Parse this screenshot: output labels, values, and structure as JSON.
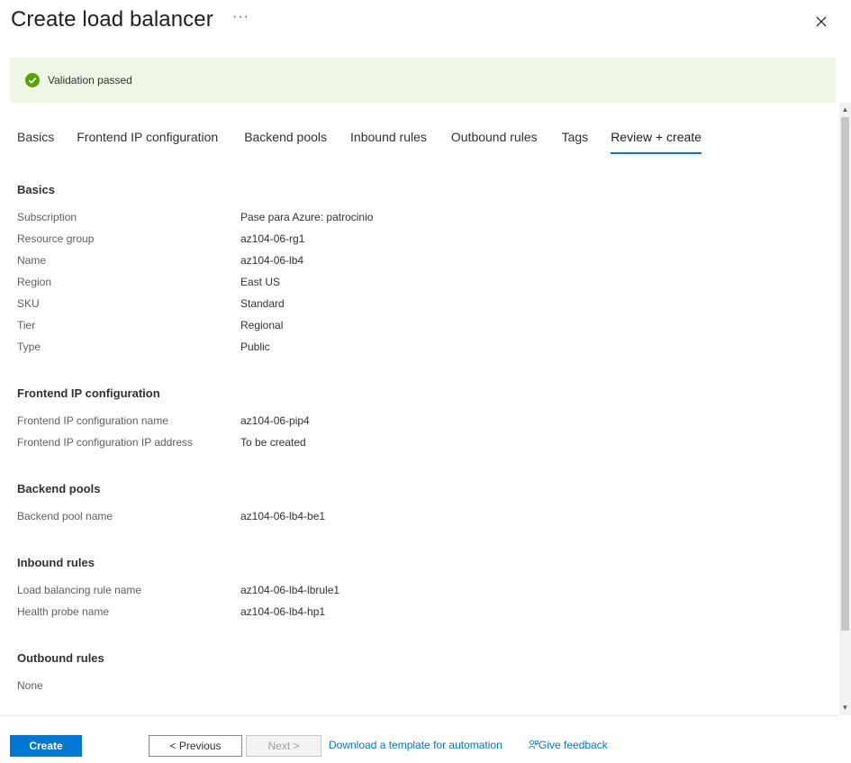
{
  "header": {
    "title": "Create load balancer",
    "more_label": "···"
  },
  "banner": {
    "text": "Validation passed",
    "icon": "check-circle-icon",
    "color": "#57a300"
  },
  "tabs": [
    {
      "label": "Basics"
    },
    {
      "label": "Frontend IP configuration"
    },
    {
      "label": "Backend pools"
    },
    {
      "label": "Inbound rules"
    },
    {
      "label": "Outbound rules"
    },
    {
      "label": "Tags"
    },
    {
      "label": "Review + create",
      "active": true
    }
  ],
  "sections": {
    "basics": {
      "title": "Basics",
      "rows": [
        {
          "label": "Subscription",
          "value": "Pase para Azure: patrocinio"
        },
        {
          "label": "Resource group",
          "value": "az104-06-rg1"
        },
        {
          "label": "Name",
          "value": "az104-06-lb4"
        },
        {
          "label": "Region",
          "value": "East US"
        },
        {
          "label": "SKU",
          "value": "Standard"
        },
        {
          "label": "Tier",
          "value": "Regional"
        },
        {
          "label": "Type",
          "value": "Public"
        }
      ]
    },
    "frontend": {
      "title": "Frontend IP configuration",
      "rows": [
        {
          "label": "Frontend IP configuration name",
          "value": "az104-06-pip4"
        },
        {
          "label": "Frontend IP configuration IP address",
          "value": "To be created"
        }
      ]
    },
    "backend": {
      "title": "Backend pools",
      "rows": [
        {
          "label": "Backend pool name",
          "value": "az104-06-lb4-be1"
        }
      ]
    },
    "inbound": {
      "title": "Inbound rules",
      "rows": [
        {
          "label": "Load balancing rule name",
          "value": "az104-06-lb4-lbrule1"
        },
        {
          "label": "Health probe name",
          "value": "az104-06-lb4-hp1"
        }
      ]
    },
    "outbound": {
      "title": "Outbound rules",
      "none_label": "None"
    }
  },
  "footer": {
    "create_label": "Create",
    "previous_label": "< Previous",
    "next_label": "Next >",
    "download_label": "Download a template for automation",
    "feedback_label": "Give feedback"
  },
  "colors": {
    "accent": "#0078d4",
    "banner_bg": "#eef6e5"
  }
}
